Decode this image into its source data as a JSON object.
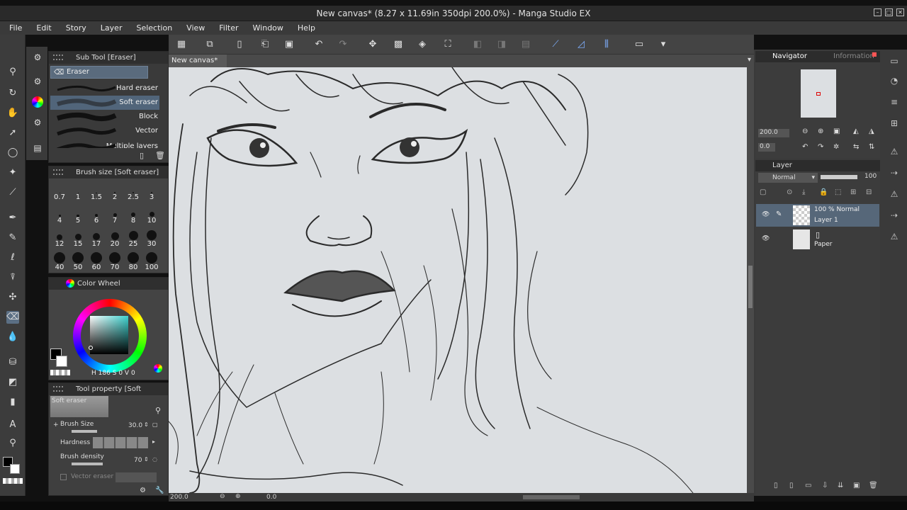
{
  "window": {
    "title": "New canvas* (8.27 x 11.69in 350dpi 200.0%)  - Manga Studio EX"
  },
  "menu": [
    "File",
    "Edit",
    "Story",
    "Layer",
    "Selection",
    "View",
    "Filter",
    "Window",
    "Help"
  ],
  "canvas_tab": {
    "label": "New canvas*",
    "close": "×"
  },
  "subtool": {
    "title": "Sub Tool [Eraser]",
    "tab": "Eraser",
    "items": [
      {
        "label": "Hard eraser"
      },
      {
        "label": "Soft eraser"
      },
      {
        "label": "Block"
      },
      {
        "label": "Vector"
      },
      {
        "label": "Multiple layers"
      }
    ]
  },
  "brush_size": {
    "title": "Brush size [Soft eraser]",
    "values": [
      "0.7",
      "1",
      "1.5",
      "2",
      "2.5",
      "3",
      "4",
      "5",
      "6",
      "7",
      "8",
      "10",
      "12",
      "15",
      "17",
      "20",
      "25",
      "30",
      "40",
      "50",
      "60",
      "70",
      "80",
      "100"
    ]
  },
  "color_wheel": {
    "title": "Color Wheel",
    "h_label": "H",
    "h_value": "186",
    "s_label": "S",
    "s_value": "0",
    "v_label": "V",
    "v_value": "0"
  },
  "tool_property": {
    "title": "Tool property [Soft eraser]",
    "preset_label": "Soft eraser",
    "brush_size_label": "Brush Size",
    "brush_size_value": "30.0",
    "hardness_label": "Hardness",
    "density_label": "Brush density",
    "density_value": "70",
    "vector_label": "Vector eraser"
  },
  "status": {
    "zoom": "200.0",
    "angle": "0.0"
  },
  "navigator": {
    "tab": "Navigator",
    "tab2": "Information",
    "zoom": "200.0",
    "angle": "0.0"
  },
  "layer_panel": {
    "title": "Layer",
    "blend_mode": "Normal",
    "opacity": "100",
    "layers": [
      {
        "meta": "100 %  Normal",
        "name": "Layer 1"
      },
      {
        "meta": "",
        "name": "Paper"
      }
    ]
  },
  "colors": {
    "accent": "#5a6b7d",
    "panel": "#3a3a3a",
    "canvas": "#dcdfe2"
  }
}
